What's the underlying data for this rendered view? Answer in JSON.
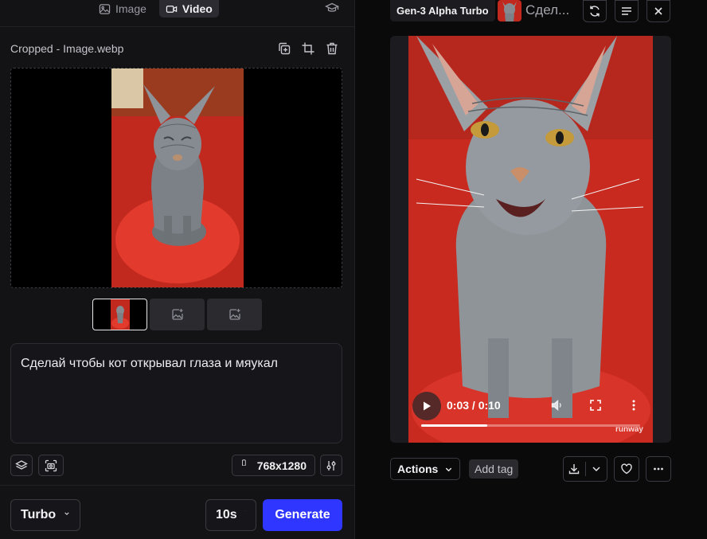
{
  "mode_tabs": [
    {
      "label": "Image",
      "icon": "image-icon",
      "active": false
    },
    {
      "label": "Video",
      "icon": "video-icon",
      "active": true
    }
  ],
  "file": {
    "name": "Cropped - Image.webp"
  },
  "prompt": {
    "text": "Сделай чтобы кот открывал глаза и мяукал"
  },
  "resolution": {
    "value": "768x1280"
  },
  "controls": {
    "mode": "Turbo",
    "duration": "10s",
    "generate_label": "Generate"
  },
  "generation": {
    "model": "Gen-3 Alpha Turbo",
    "title": "Сдел...",
    "time_display": "0:03 / 0:10",
    "progress": 0.3,
    "watermark": "runway"
  },
  "result_toolbar": {
    "actions_label": "Actions",
    "add_tag_label": "Add tag"
  },
  "colors": {
    "accent": "#2f36ff",
    "panel": "#131316",
    "background": "#0a0a0b"
  }
}
